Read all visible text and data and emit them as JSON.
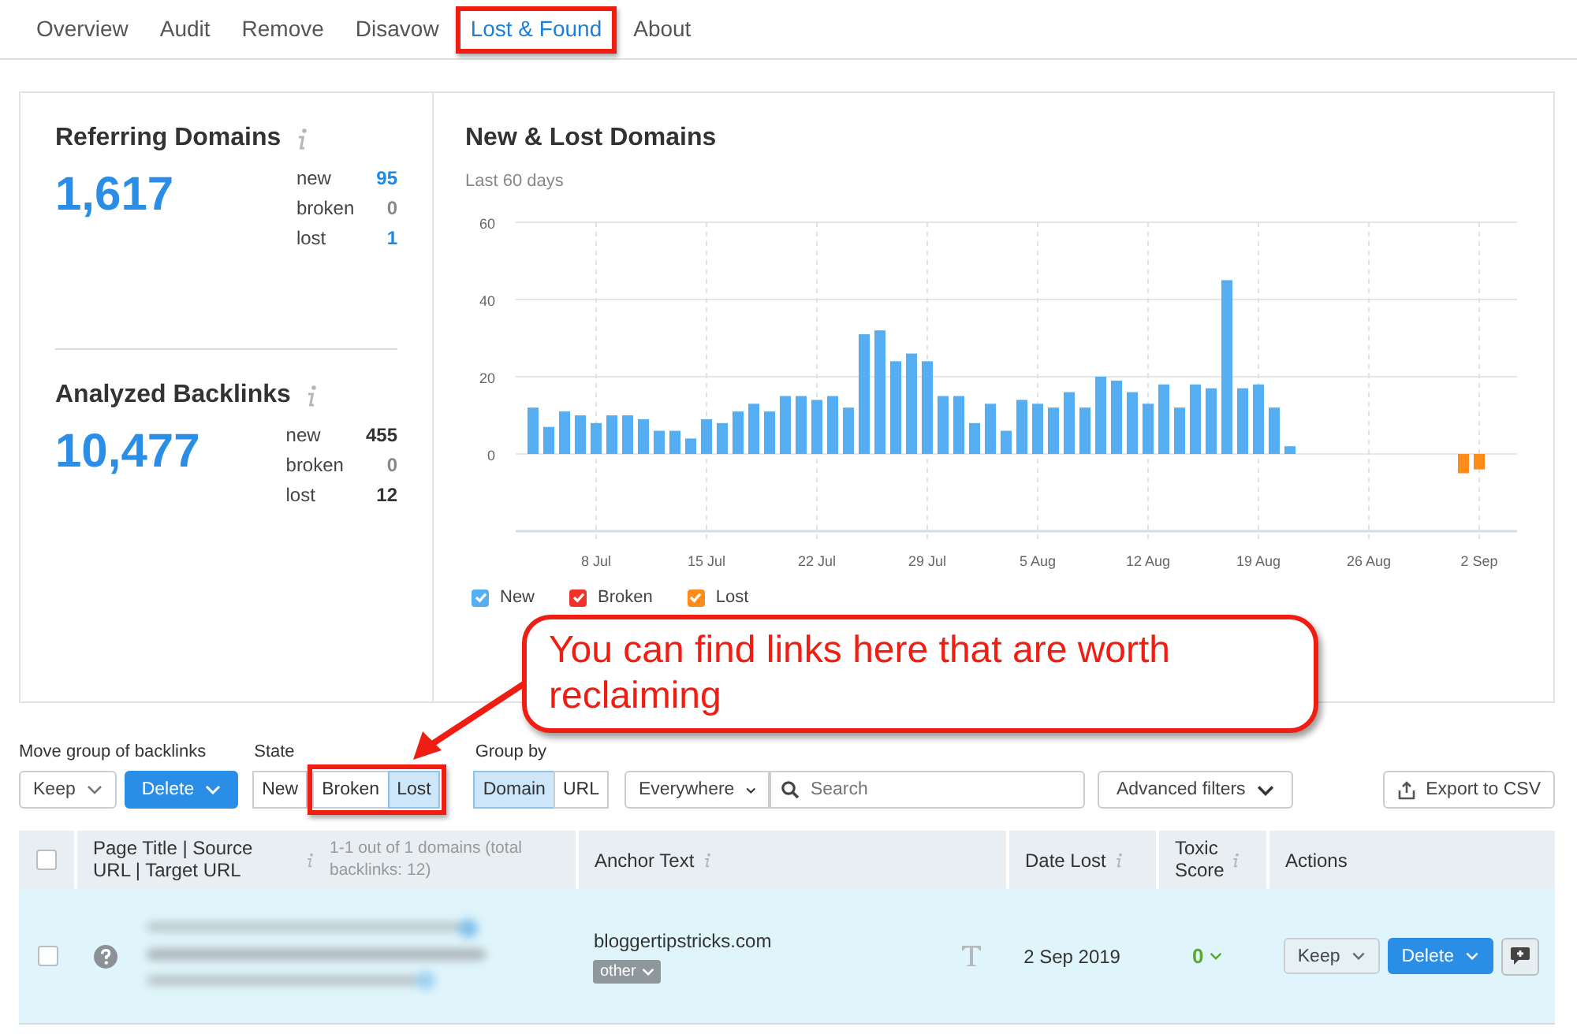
{
  "tabs": [
    {
      "label": "Overview",
      "selected": false,
      "highlighted": false
    },
    {
      "label": "Audit",
      "selected": false,
      "highlighted": false
    },
    {
      "label": "Remove",
      "selected": false,
      "highlighted": false
    },
    {
      "label": "Disavow",
      "selected": false,
      "highlighted": false
    },
    {
      "label": "Lost & Found",
      "selected": true,
      "highlighted": true
    },
    {
      "label": "About",
      "selected": false,
      "highlighted": false
    }
  ],
  "summary": [
    {
      "title": "Referring Domains",
      "total": "1,617",
      "stats": [
        {
          "label": "new",
          "value": "95",
          "color": "#1e88e5"
        },
        {
          "label": "broken",
          "value": "0",
          "color": "#888888"
        },
        {
          "label": "lost",
          "value": "1",
          "color": "#1e88e5"
        }
      ]
    },
    {
      "title": "Analyzed Backlinks",
      "total": "10,477",
      "stats": [
        {
          "label": "new",
          "value": "455",
          "color": "#333333"
        },
        {
          "label": "broken",
          "value": "0",
          "color": "#888888"
        },
        {
          "label": "lost",
          "value": "12",
          "color": "#333333"
        }
      ]
    }
  ],
  "chart": {
    "title": "New & Lost Domains",
    "subtitle": "Last 60 days",
    "legend": [
      {
        "checked": true
      },
      {
        "checked": true
      },
      {
        "checked": true
      }
    ],
    "chart_data": {
      "type": "bar",
      "stacked": true,
      "grid": true,
      "categories": [
        null,
        null,
        null,
        null,
        "8 Jul",
        null,
        null,
        null,
        null,
        null,
        null,
        "15 Jul",
        null,
        null,
        null,
        null,
        null,
        null,
        "22 Jul",
        null,
        null,
        null,
        null,
        null,
        null,
        "29 Jul",
        null,
        null,
        null,
        null,
        null,
        null,
        "5 Aug",
        null,
        null,
        null,
        null,
        null,
        null,
        "12 Aug",
        null,
        null,
        null,
        null,
        null,
        null,
        "19 Aug",
        null,
        null,
        null,
        null,
        null,
        null,
        "26 Aug",
        null,
        null,
        null,
        null,
        null,
        null,
        "2 Sep"
      ],
      "series": [
        {
          "name": "New",
          "color": "#55aef2",
          "values": [
            12,
            7,
            11,
            10,
            8,
            10,
            10,
            9,
            6,
            6,
            4,
            9,
            8,
            11,
            13,
            11,
            15,
            15,
            14,
            15,
            12,
            31,
            32,
            24,
            26,
            24,
            15,
            15,
            8,
            13,
            6,
            14,
            13,
            12,
            16,
            12,
            20,
            19,
            16,
            13,
            18,
            12,
            18,
            17,
            45,
            17,
            18,
            12,
            2,
            null,
            null,
            null,
            null,
            null,
            null,
            null,
            null,
            null,
            null,
            null,
            null
          ]
        },
        {
          "name": "Broken",
          "color": "#f0322a",
          "values": [
            0,
            0,
            0,
            0,
            0,
            0,
            0,
            0,
            0,
            0,
            0,
            0,
            0,
            0,
            0,
            0,
            0,
            0,
            0,
            0,
            0,
            0,
            0,
            0,
            0,
            0,
            0,
            0,
            0,
            0,
            0,
            0,
            0,
            0,
            0,
            0,
            0,
            0,
            0,
            0,
            0,
            0,
            0,
            0,
            0,
            0,
            0,
            0,
            0,
            0,
            0,
            0,
            0,
            0,
            0,
            0,
            0,
            0,
            0,
            0,
            0
          ]
        },
        {
          "name": "Lost",
          "color": "#ff8c1a",
          "values": [
            null,
            null,
            null,
            null,
            null,
            null,
            null,
            null,
            null,
            null,
            null,
            null,
            null,
            null,
            null,
            null,
            null,
            null,
            null,
            null,
            null,
            null,
            null,
            null,
            null,
            null,
            null,
            null,
            null,
            null,
            null,
            null,
            null,
            null,
            null,
            null,
            null,
            null,
            null,
            null,
            null,
            null,
            null,
            null,
            null,
            null,
            null,
            null,
            null,
            null,
            null,
            null,
            null,
            null,
            null,
            null,
            null,
            null,
            null,
            -5,
            -4
          ]
        }
      ],
      "ylim": [
        -20,
        60
      ],
      "yticks": [
        0,
        20,
        40,
        60
      ]
    }
  },
  "toolbar": {
    "move_group": {
      "label": "Move group of backlinks",
      "keep": "Keep",
      "delete": "Delete"
    },
    "state": {
      "label": "State",
      "options": [
        {
          "label": "New",
          "selected": false,
          "highlighted": false
        },
        {
          "label": "Broken",
          "selected": false,
          "highlighted": true
        },
        {
          "label": "Lost",
          "selected": true,
          "highlighted": true
        }
      ]
    },
    "group_by": {
      "label": "Group by",
      "options": [
        {
          "label": "Domain",
          "selected": true
        },
        {
          "label": "URL",
          "selected": false
        }
      ]
    },
    "scope": "Everywhere",
    "search": {
      "placeholder": "Search"
    },
    "advanced_filters": "Advanced filters",
    "export": "Export to CSV"
  },
  "table": {
    "header_checked": false,
    "columns": [
      {
        "label": "Page Title | Source URL | Target URL",
        "info": true
      },
      {
        "label": "Anchor Text",
        "info": true
      },
      {
        "label": "Date Lost",
        "info": true
      },
      {
        "label": "Toxic Score",
        "info": true
      },
      {
        "label": "Actions",
        "info": false
      }
    ],
    "count_note": "1-1 out of 1 domains (total backlinks: 12)",
    "rows": [
      {
        "checked": false,
        "anchor": "bloggertipstricks.com",
        "anchor_tag": "other",
        "date_lost": "2 Sep 2019",
        "toxic_score": "0",
        "keep": "Keep",
        "delete": "Delete"
      }
    ]
  },
  "callout": {
    "text": "You can find links here that are worth reclaiming"
  }
}
